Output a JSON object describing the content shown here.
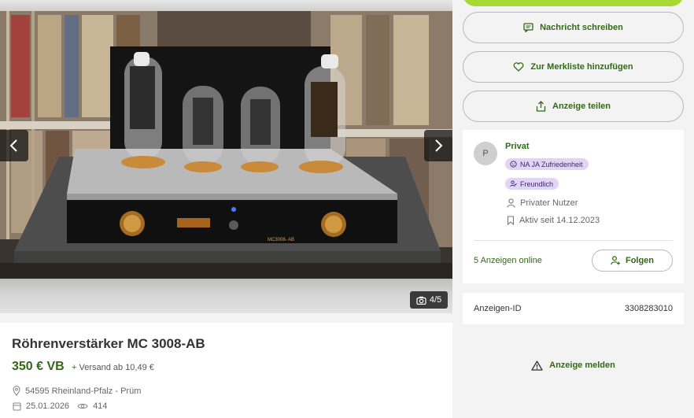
{
  "gallery": {
    "counter": "4/5",
    "amp_label": "MC3008- AB"
  },
  "listing": {
    "title": "Röhrenverstärker MC 3008-AB",
    "price": "350 € VB",
    "shipping": "+ Versand ab 10,49 €",
    "location": "54595 Rheinland-Pfalz - Prüm",
    "date": "25.01.2026",
    "views": "414"
  },
  "actions": {
    "message": "Nachricht schreiben",
    "watchlist": "Zur Merkliste hinzufügen",
    "share": "Anzeige teilen"
  },
  "seller": {
    "avatar_initial": "P",
    "name": "Privat",
    "badge_satisfaction": "NA JA Zufriedenheit",
    "badge_friendly": "Freundlich",
    "type": "Privater Nutzer",
    "active_since": "Aktiv seit 14.12.2023",
    "ads_online": "5 Anzeigen online",
    "follow": "Folgen"
  },
  "ad_id": {
    "label": "Anzeigen-ID",
    "value": "3308283010"
  },
  "report": "Anzeige melden",
  "colors": {
    "brand_green": "#326916",
    "accent_lime": "#a6d932",
    "badge_purple": "#e2d4f7"
  }
}
